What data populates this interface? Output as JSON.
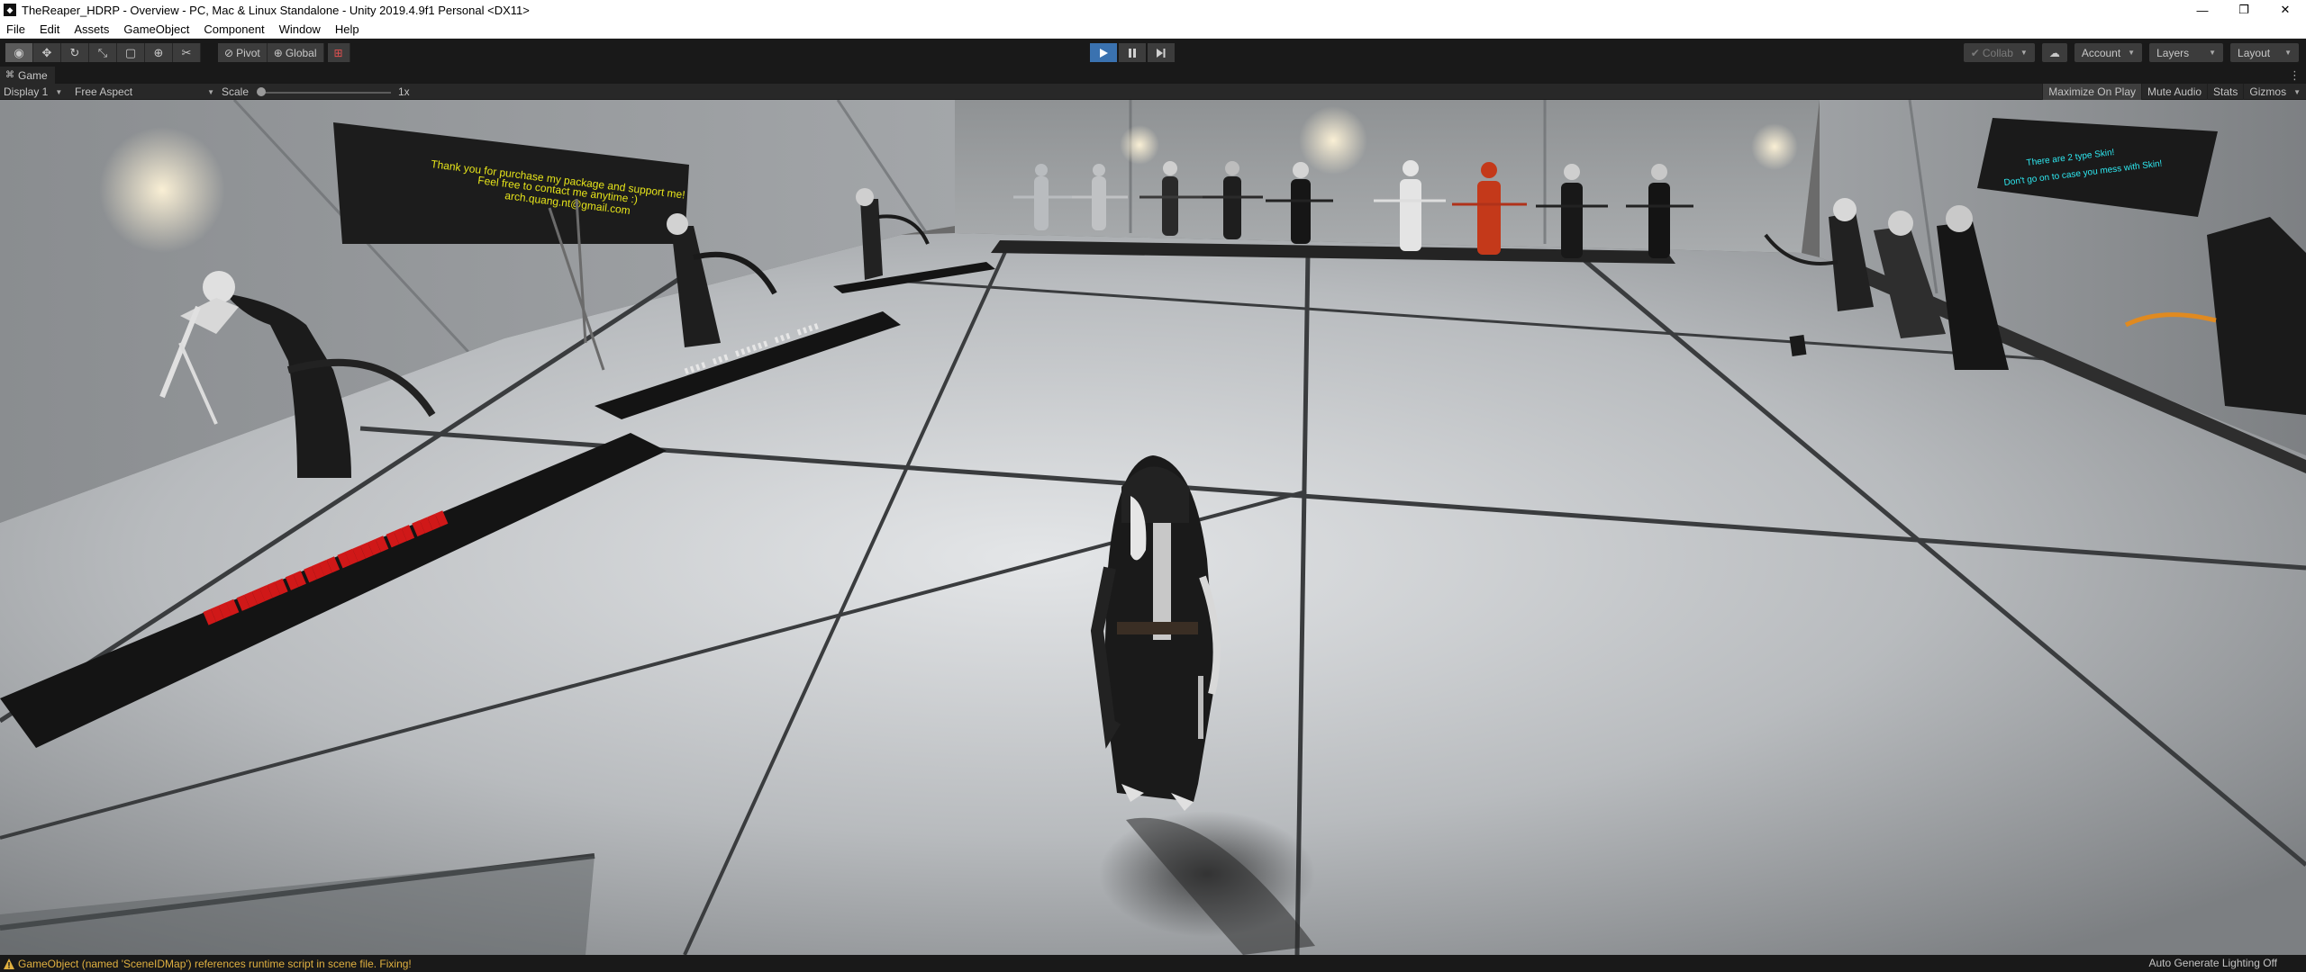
{
  "window": {
    "title": "TheReaper_HDRP - Overview - PC, Mac & Linux Standalone - Unity 2019.4.9f1 Personal <DX11>",
    "minimize_glyph": "—",
    "maximize_glyph": "❐",
    "close_glyph": "✕"
  },
  "menu": [
    "File",
    "Edit",
    "Assets",
    "GameObject",
    "Component",
    "Window",
    "Help"
  ],
  "toolbar": {
    "tools": [
      {
        "icon": "hand-tool-icon",
        "glyph": "◉",
        "active": true
      },
      {
        "icon": "move-tool-icon",
        "glyph": "✥",
        "active": false
      },
      {
        "icon": "rotate-tool-icon",
        "glyph": "↻",
        "active": false
      },
      {
        "icon": "scale-tool-icon",
        "glyph": "⤡",
        "active": false
      },
      {
        "icon": "rect-tool-icon",
        "glyph": "▢",
        "active": false
      },
      {
        "icon": "transform-tool-icon",
        "glyph": "⊕",
        "active": false
      },
      {
        "icon": "custom-tool-icon",
        "glyph": "✂",
        "active": false
      }
    ],
    "pivot_label": "Pivot",
    "global_label": "Global",
    "play_state": "playing",
    "collab_label": "Collab",
    "account_label": "Account",
    "layers_label": "Layers",
    "layout_label": "Layout"
  },
  "game_view": {
    "tab_label": "Game",
    "display": "Display 1",
    "aspect": "Free Aspect",
    "scale_label": "Scale",
    "scale_value": "1x",
    "scale_level": 0.0,
    "toggles": [
      "Maximize On Play",
      "Mute Audio",
      "Stats",
      "Gizmos"
    ],
    "scene": {
      "left_sign_lines": [
        "Thank you for purchase my package and support me!",
        "Feel free to contact me anytime :)",
        "arch.quang.nt@gmail.com"
      ],
      "right_sign_lines": [
        "There are 2 type Skin!",
        "Don't go on to case you mess with Skin!"
      ]
    }
  },
  "status": {
    "message": "GameObject (named 'SceneIDMap') references runtime script in scene file. Fixing!",
    "right_text": "Auto Generate Lighting Off"
  },
  "colors": {
    "unity_dark": "#191919",
    "panel": "#282828",
    "play_active": "#3a72b0",
    "warning": "#e0b040",
    "sign_text": "#e6e41a",
    "right_sign_text": "#2ee8f0",
    "red_label": "#d01818"
  }
}
